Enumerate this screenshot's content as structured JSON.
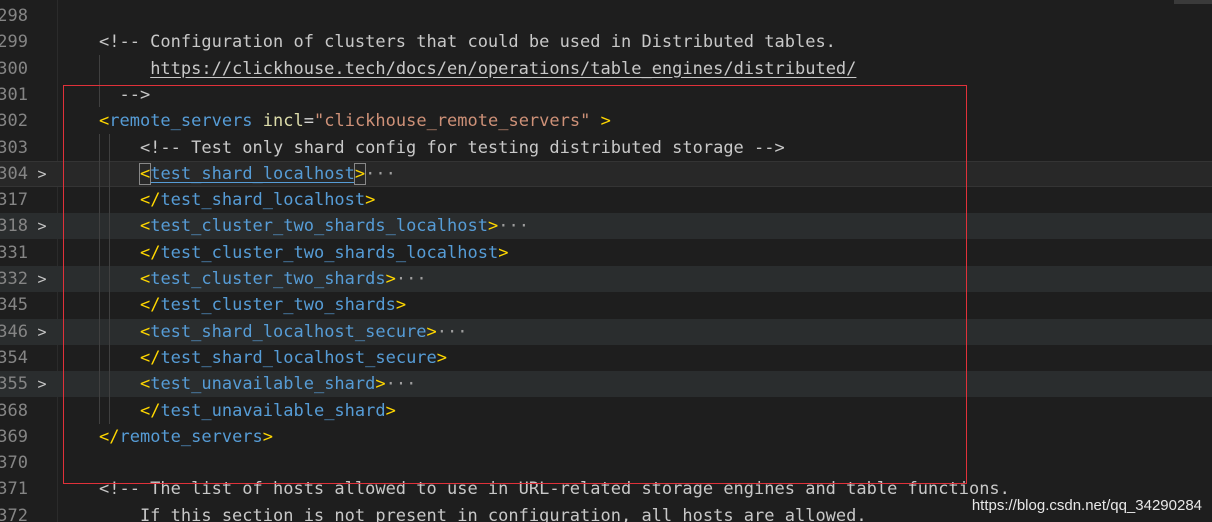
{
  "editor": {
    "lines": [
      {
        "num": "298",
        "fold": "",
        "segments": []
      },
      {
        "num": "299",
        "fold": "",
        "segments": [
          {
            "t": "<!-- Configuration of clusters that could be used in Distributed tables.",
            "c": "c-comment"
          }
        ]
      },
      {
        "num": "300",
        "fold": "",
        "segments": [
          {
            "t": "     ",
            "c": ""
          },
          {
            "t": "https://clickhouse.tech/docs/en/operations/table_engines/distributed/",
            "c": "c-link"
          }
        ]
      },
      {
        "num": "301",
        "fold": "",
        "segments": [
          {
            "t": "  -->",
            "c": "c-comment"
          }
        ]
      },
      {
        "num": "302",
        "fold": "",
        "segments": [
          {
            "t": "<",
            "c": "c-bracket"
          },
          {
            "t": "remote_servers",
            "c": "c-tag"
          },
          {
            "t": " ",
            "c": ""
          },
          {
            "t": "incl",
            "c": "c-attr"
          },
          {
            "t": "=",
            "c": "c-eq"
          },
          {
            "t": "\"clickhouse_remote_servers\"",
            "c": "c-str"
          },
          {
            "t": " ",
            "c": ""
          },
          {
            "t": ">",
            "c": "c-bracket"
          }
        ]
      },
      {
        "num": "303",
        "fold": "",
        "segments": [
          {
            "t": "    <!-- Test only shard config for testing distributed storage -->",
            "c": "c-comment"
          }
        ]
      },
      {
        "num": "304",
        "fold": ">",
        "segments": [
          {
            "t": "    ",
            "c": ""
          },
          {
            "t": "<",
            "c": "c-bracket bracket-box"
          },
          {
            "t": "test_shard_localhost",
            "c": "c-tagu"
          },
          {
            "t": ">",
            "c": "c-bracket bracket-box"
          },
          {
            "t": "···",
            "c": "c-ellipsis"
          }
        ]
      },
      {
        "num": "317",
        "fold": "",
        "segments": [
          {
            "t": "    ",
            "c": ""
          },
          {
            "t": "</",
            "c": "c-bracket"
          },
          {
            "t": "test_shard_localhost",
            "c": "c-tag"
          },
          {
            "t": ">",
            "c": "c-bracket"
          }
        ]
      },
      {
        "num": "318",
        "fold": ">",
        "segments": [
          {
            "t": "    ",
            "c": ""
          },
          {
            "t": "<",
            "c": "c-bracket"
          },
          {
            "t": "test_cluster_two_shards_localhost",
            "c": "c-tag"
          },
          {
            "t": ">",
            "c": "c-bracket"
          },
          {
            "t": "···",
            "c": "c-ellipsis"
          }
        ]
      },
      {
        "num": "331",
        "fold": "",
        "segments": [
          {
            "t": "    ",
            "c": ""
          },
          {
            "t": "</",
            "c": "c-bracket"
          },
          {
            "t": "test_cluster_two_shards_localhost",
            "c": "c-tag"
          },
          {
            "t": ">",
            "c": "c-bracket"
          }
        ]
      },
      {
        "num": "332",
        "fold": ">",
        "segments": [
          {
            "t": "    ",
            "c": ""
          },
          {
            "t": "<",
            "c": "c-bracket"
          },
          {
            "t": "test_cluster_two_shards",
            "c": "c-tag"
          },
          {
            "t": ">",
            "c": "c-bracket"
          },
          {
            "t": "···",
            "c": "c-ellipsis"
          }
        ]
      },
      {
        "num": "345",
        "fold": "",
        "segments": [
          {
            "t": "    ",
            "c": ""
          },
          {
            "t": "</",
            "c": "c-bracket"
          },
          {
            "t": "test_cluster_two_shards",
            "c": "c-tag"
          },
          {
            "t": ">",
            "c": "c-bracket"
          }
        ]
      },
      {
        "num": "346",
        "fold": ">",
        "segments": [
          {
            "t": "    ",
            "c": ""
          },
          {
            "t": "<",
            "c": "c-bracket"
          },
          {
            "t": "test_shard_localhost_secure",
            "c": "c-tag"
          },
          {
            "t": ">",
            "c": "c-bracket"
          },
          {
            "t": "···",
            "c": "c-ellipsis"
          }
        ]
      },
      {
        "num": "354",
        "fold": "",
        "segments": [
          {
            "t": "    ",
            "c": ""
          },
          {
            "t": "</",
            "c": "c-bracket"
          },
          {
            "t": "test_shard_localhost_secure",
            "c": "c-tag"
          },
          {
            "t": ">",
            "c": "c-bracket"
          }
        ]
      },
      {
        "num": "355",
        "fold": ">",
        "segments": [
          {
            "t": "    ",
            "c": ""
          },
          {
            "t": "<",
            "c": "c-bracket"
          },
          {
            "t": "test_unavailable_shard",
            "c": "c-tag"
          },
          {
            "t": ">",
            "c": "c-bracket"
          },
          {
            "t": "···",
            "c": "c-ellipsis"
          }
        ]
      },
      {
        "num": "368",
        "fold": "",
        "segments": [
          {
            "t": "    ",
            "c": ""
          },
          {
            "t": "</",
            "c": "c-bracket"
          },
          {
            "t": "test_unavailable_shard",
            "c": "c-tag"
          },
          {
            "t": ">",
            "c": "c-bracket"
          }
        ]
      },
      {
        "num": "369",
        "fold": "",
        "segments": [
          {
            "t": "</",
            "c": "c-bracket"
          },
          {
            "t": "remote_servers",
            "c": "c-tag"
          },
          {
            "t": ">",
            "c": "c-bracket"
          }
        ]
      },
      {
        "num": "370",
        "fold": "",
        "segments": []
      },
      {
        "num": "371",
        "fold": "",
        "segments": [
          {
            "t": "<!-- The list of hosts allowed to use in URL-related storage engines and table functions.",
            "c": "c-comment"
          }
        ]
      },
      {
        "num": "372",
        "fold": "",
        "segments": [
          {
            "t": "    If this section is not present in configuration, all hosts are allowed.",
            "c": "c-comment"
          }
        ]
      }
    ]
  },
  "watermark": {
    "text": "https://blog.csdn.net/qq_34290284"
  },
  "colors": {
    "background": "#1e1e1e",
    "annotation_box": "#e0313a",
    "tag": "#569cd6",
    "bracket": "#ffd700",
    "attribute": "#dcdcaa",
    "string": "#ce9178"
  }
}
